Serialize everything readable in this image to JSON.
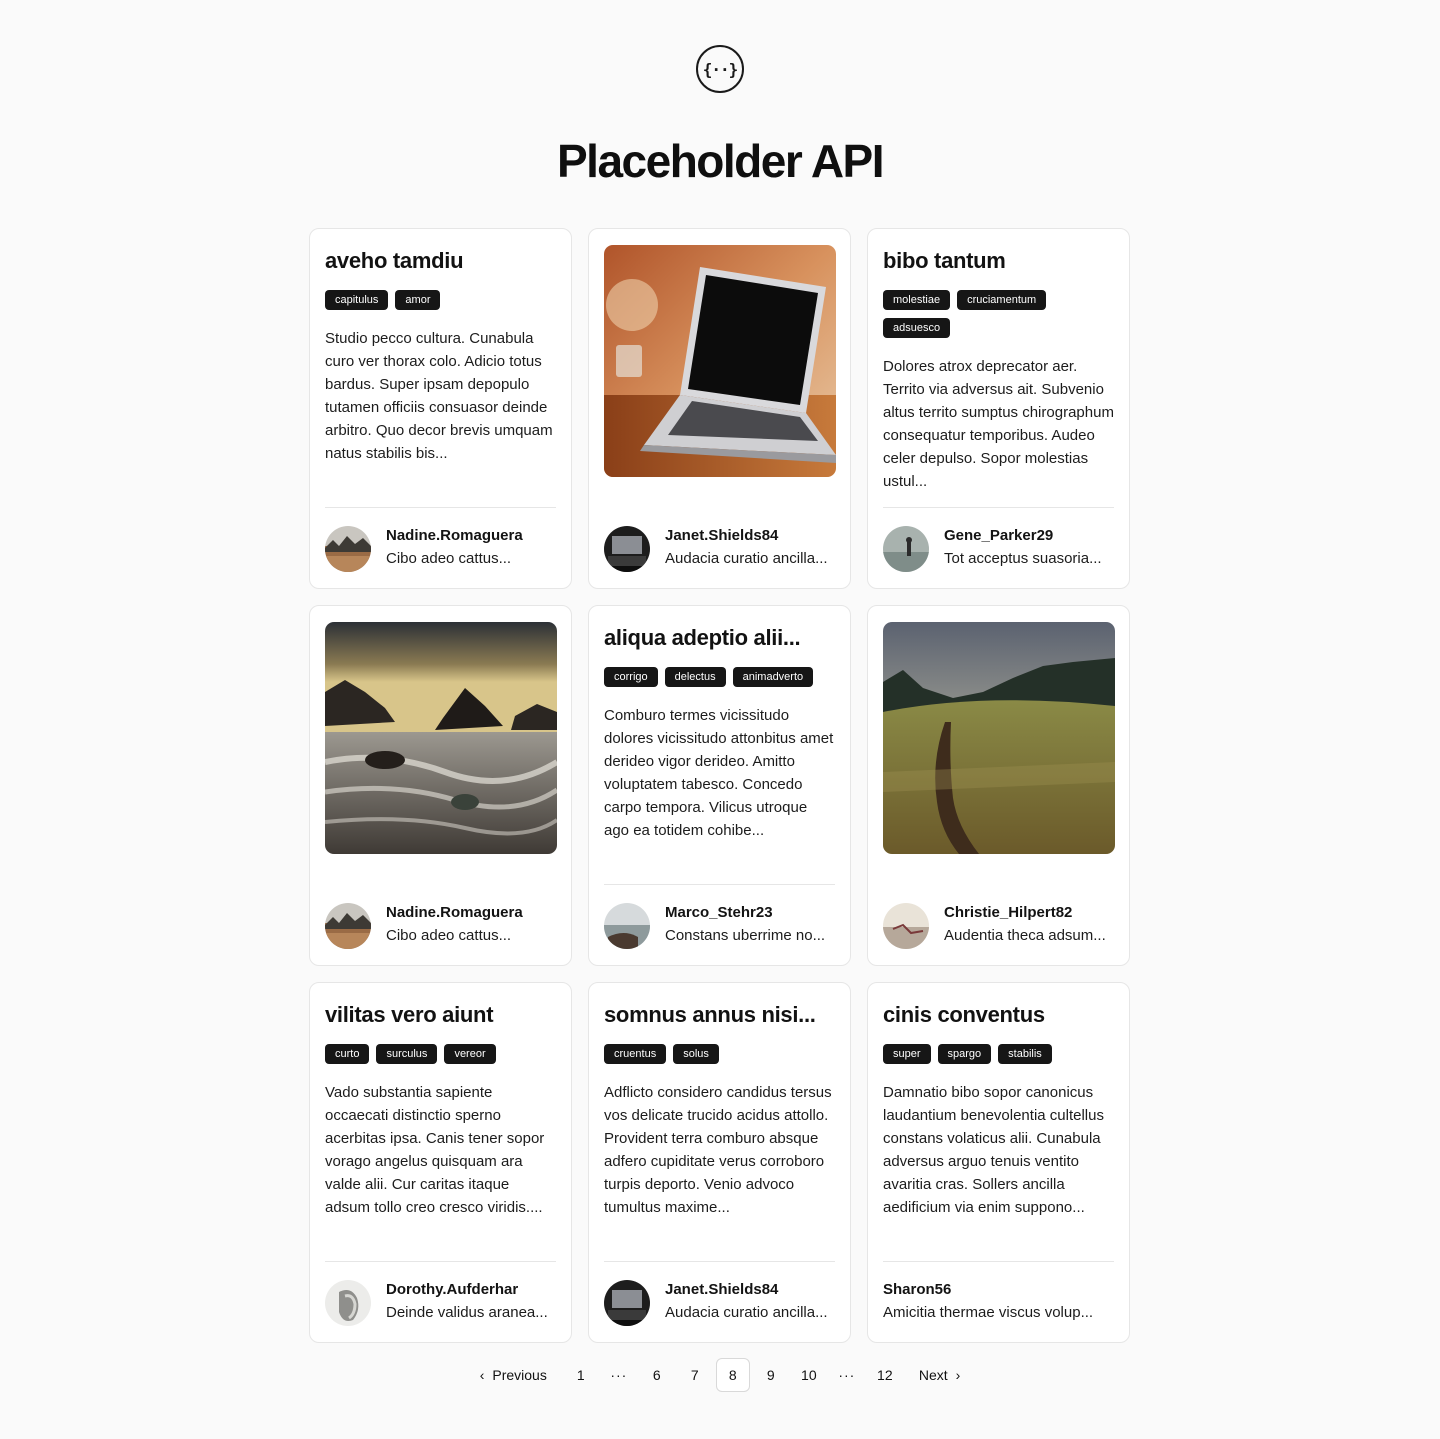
{
  "logo": {
    "glyph": "{··}",
    "icon": "api-braces-icon"
  },
  "page_title": "Placeholder API",
  "cards": [
    {
      "title": "aveho tamdiu",
      "tags": [
        "capitulus",
        "amor"
      ],
      "body": "Studio pecco cultura. Cunabula curo ver thorax colo. Adicio totus bardus. Super ipsam depopulo tutamen officiis consuasor deinde arbitro. Quo decor brevis umquam natus stabilis bis...",
      "author": {
        "name": "Nadine.Romaguera",
        "bio": "Cibo adeo cattus..."
      }
    },
    {
      "image": "laptop",
      "author": {
        "name": "Janet.Shields84",
        "bio": "Audacia curatio ancilla..."
      }
    },
    {
      "title": "bibo tantum",
      "tags": [
        "molestiae",
        "cruciamentum",
        "adsuesco"
      ],
      "body": "Dolores atrox deprecator aer. Territo via adversus ait. Subvenio altus territo sumptus chirographum consequatur temporibus. Audeo celer depulso. Sopor molestias ustul...",
      "author": {
        "name": "Gene_Parker29",
        "bio": "Tot acceptus suasoria..."
      }
    },
    {
      "image": "seascape",
      "author": {
        "name": "Nadine.Romaguera",
        "bio": "Cibo adeo cattus..."
      }
    },
    {
      "title": "aliqua adeptio alii...",
      "tags": [
        "corrigo",
        "delectus",
        "animadverto"
      ],
      "body": "Comburo termes vicissitudo dolores vicissitudo attonbitus amet derideo vigor derideo. Amitto voluptatem tabesco. Concedo carpo tempora. Vilicus utroque ago ea totidem cohibe...",
      "author": {
        "name": "Marco_Stehr23",
        "bio": "Constans uberrime no..."
      }
    },
    {
      "image": "meadow",
      "author": {
        "name": "Christie_Hilpert82",
        "bio": "Audentia theca adsum..."
      }
    },
    {
      "title": "vilitas vero aiunt",
      "tags": [
        "curto",
        "surculus",
        "vereor"
      ],
      "body": "Vado substantia sapiente occaecati distinctio sperno acerbitas ipsa. Canis tener sopor vorago angelus quisquam ara valde alii. Cur caritas itaque adsum tollo creo cresco viridis....",
      "author": {
        "name": "Dorothy.Aufderhar",
        "bio": "Deinde validus aranea..."
      }
    },
    {
      "title": "somnus annus nisi...",
      "tags": [
        "cruentus",
        "solus"
      ],
      "body": "Adflicto considero candidus tersus vos delicate trucido acidus attollo. Provident terra comburo absque adfero cupiditate verus corroboro turpis deporto. Venio advoco tumultus maxime...",
      "author": {
        "name": "Janet.Shields84",
        "bio": "Audacia curatio ancilla..."
      }
    },
    {
      "title": "cinis conventus",
      "tags": [
        "super",
        "spargo",
        "stabilis"
      ],
      "body": "Damnatio bibo sopor canonicus laudantium benevolentia cultellus constans volaticus alii. Cunabula adversus arguo tenuis ventito avaritia cras. Sollers ancilla aedificium via enim suppono...",
      "author": {
        "name": "Sharon56",
        "bio": "Amicitia thermae viscus volup..."
      }
    }
  ],
  "pagination": {
    "previous": "Previous",
    "next": "Next",
    "p1": "1",
    "ellipsis": "···",
    "p6": "6",
    "p7": "7",
    "p8": "8",
    "p9": "9",
    "p10": "10",
    "p12": "12",
    "current": "8"
  }
}
